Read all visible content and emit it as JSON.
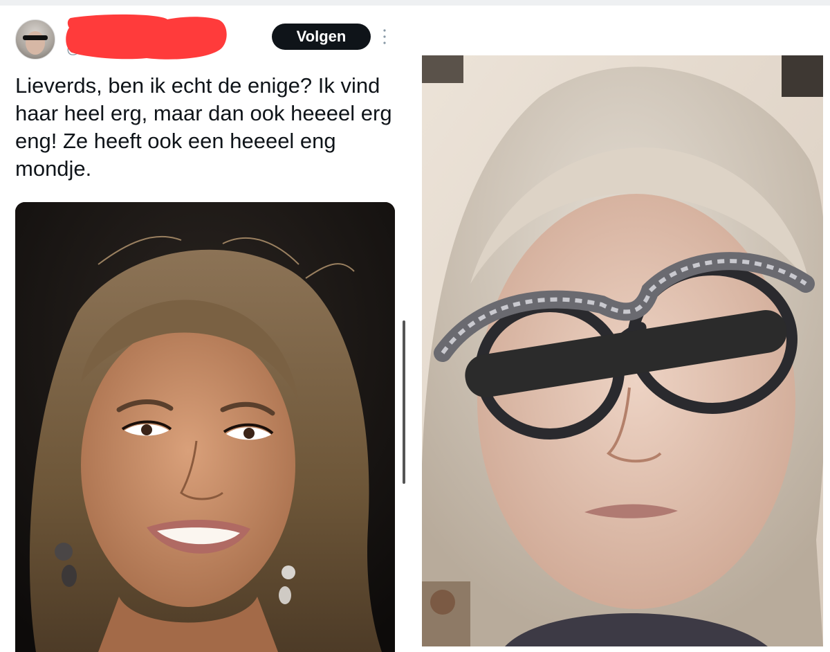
{
  "tweet": {
    "handle": "@",
    "follow_label": "Volgen",
    "text": "Lieverds, ben ik echt de enige? Ik vind haar heel erg, maar dan ook heeeel erg eng! Ze heeft ook een heeeel eng mondje.",
    "media_description": "portrait-photo-smiling-woman"
  },
  "right_panel": {
    "media_description": "portrait-photo-woman-with-glasses-redacted-eyes"
  },
  "colors": {
    "follow_bg": "#0f1419",
    "redaction_red": "#ff3b3b",
    "text": "#0f1419",
    "muted": "#8899a6"
  }
}
